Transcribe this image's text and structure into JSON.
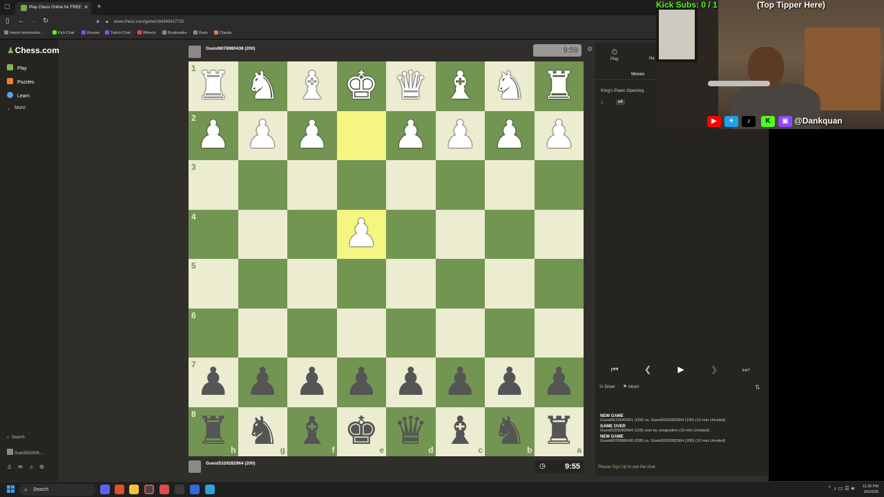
{
  "browser": {
    "tab_title": "Play Chess Online for FREE",
    "new_tab": "+",
    "url": "www.chess.com/game/164349427720",
    "bookmarks": [
      "Import bookmarks...",
      "Kick Chat",
      "Browse",
      "Twitch Chat",
      "Wheels",
      "Bookmarks",
      "Brain",
      "Claude"
    ]
  },
  "sidebar": {
    "logo": "Chess.com",
    "items": [
      {
        "label": "Play",
        "color": "#81b64c"
      },
      {
        "label": "Puzzles",
        "color": "#f1802d"
      },
      {
        "label": "Learn",
        "color": "#5d9fe8"
      },
      {
        "label": "More",
        "color": "#ffffff"
      }
    ],
    "search": "Search",
    "user": "Guest532928..."
  },
  "game": {
    "top_player": "Guest6078980438 (200)",
    "top_clock": "9:59",
    "bottom_player": "Guest5329282964 (200)",
    "bottom_clock": "9:55",
    "ranks": [
      "1",
      "2",
      "3",
      "4",
      "5",
      "6",
      "7",
      "8"
    ],
    "files": [
      "h",
      "g",
      "f",
      "e",
      "d",
      "c",
      "b",
      "a"
    ],
    "pieces": {
      "white_rook": "♜",
      "white_knight": "♞",
      "white_bishop": "♝",
      "white_king": "♚",
      "white_queen": "♛",
      "white_pawn": "♟",
      "black_rook": "♜",
      "black_knight": "♞",
      "black_bishop": "♝",
      "black_king": "♚",
      "black_queen": "♛",
      "black_pawn": "♟"
    }
  },
  "panel": {
    "tab_play": "Play",
    "tab_new": "Ne",
    "moves_tab": "Moves",
    "opening": "King's Pawn Opening",
    "move_number": "1.",
    "move": "e4",
    "draw": "Draw",
    "abort": "Abort",
    "log": [
      {
        "title": "NEW GAME",
        "text": "Guest6619542301 (100) vs. Guest5329282964 (100) (10 min Unrated)"
      },
      {
        "title": "GAME OVER",
        "text": "Guest5329282964 (100) won by resignation (10 min Unrated)"
      },
      {
        "title": "NEW GAME",
        "text": "Guest6078980438 (200) vs. Guest5329282964 (200) (10 min Unrated)"
      }
    ],
    "chat_pre": "Please ",
    "chat_link": "Sign Up",
    "chat_post": " to use the chat."
  },
  "stream": {
    "kick_subs": "Kick Subs: 0 / 1",
    "tipper": "(Top Tipper Here)",
    "handle": "@Dankquan",
    "social_icons": [
      "youtube-icon",
      "twitter-icon",
      "tiktok-icon",
      "kick-icon",
      "twitch-icon"
    ]
  },
  "taskbar": {
    "search": "Search",
    "time": "11:26 PM",
    "date": "2/6/2026"
  }
}
